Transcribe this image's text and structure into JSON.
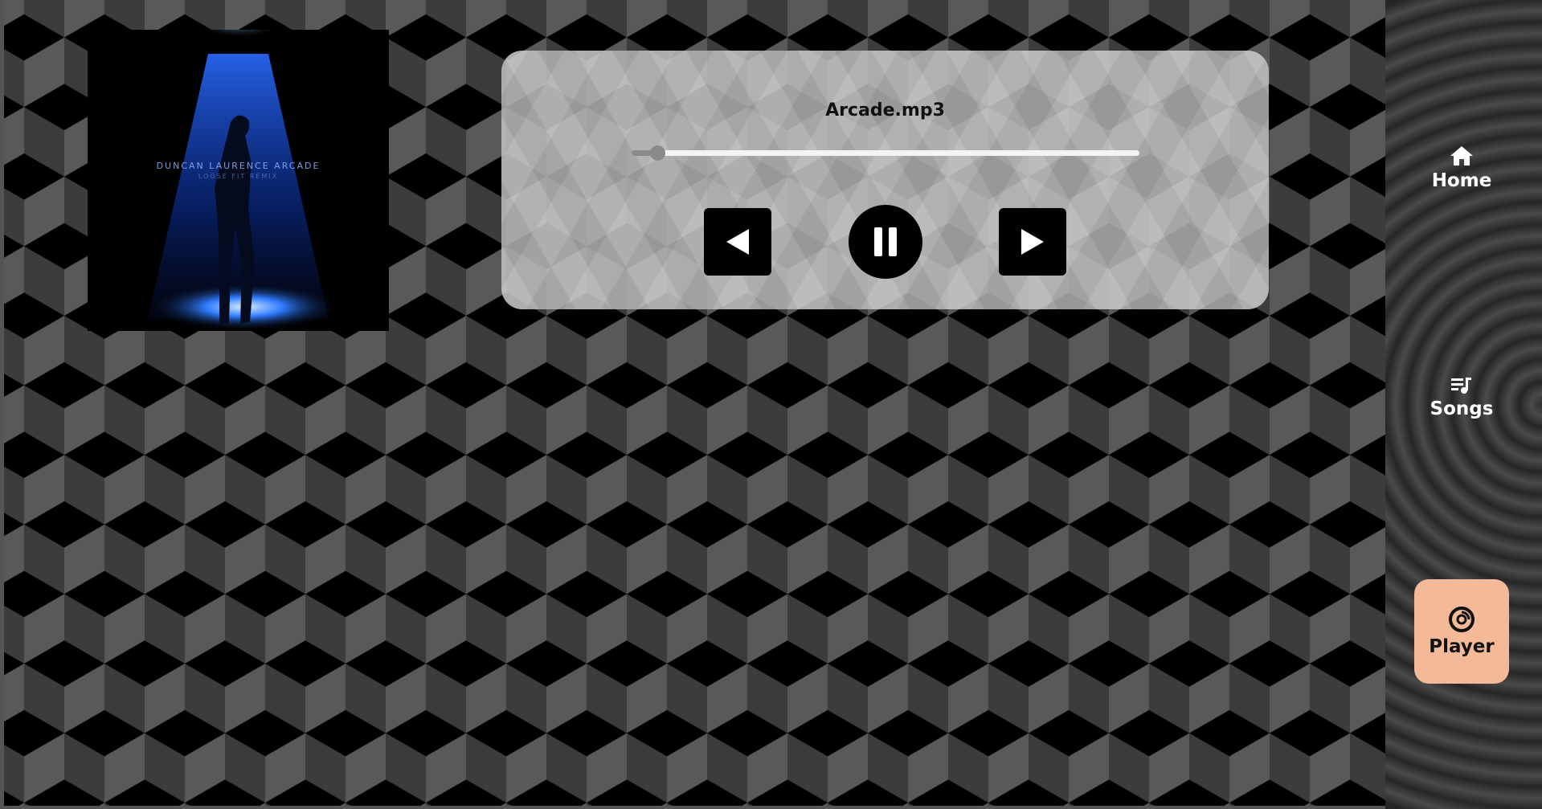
{
  "player": {
    "track_title": "Arcade.mp3",
    "progress": 0.05,
    "state": "playing"
  },
  "album_art": {
    "artist_text": "DUNCAN LAURENCE ARCADE",
    "subtitle_text": "LOOSE FIT REMIX"
  },
  "controls": {
    "prev_icon": "previous-icon",
    "play_pause_icon": "pause-icon",
    "next_icon": "next-icon"
  },
  "sidebar": {
    "items": [
      {
        "label": "Home",
        "icon": "home-icon",
        "active": false
      },
      {
        "label": "Songs",
        "icon": "playlist-icon",
        "active": false
      },
      {
        "label": "Player",
        "icon": "disc-icon",
        "active": true
      }
    ]
  },
  "colors": {
    "accent": "#f4b996",
    "panel": "#c8c8c8",
    "control": "#000000"
  }
}
